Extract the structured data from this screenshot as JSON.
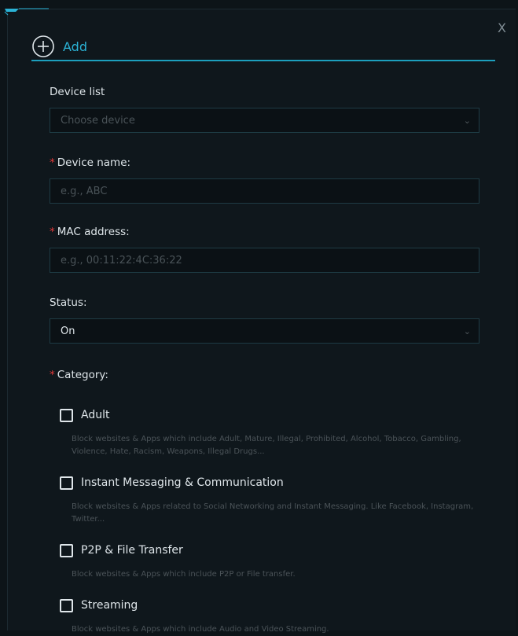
{
  "header": {
    "title": "Add",
    "close_label": "X"
  },
  "fields": {
    "device_list": {
      "label": "Device list",
      "placeholder": "Choose device"
    },
    "device_name": {
      "required_mark": "*",
      "label": "Device name:",
      "placeholder": "e.g., ABC"
    },
    "mac_address": {
      "required_mark": "*",
      "label": "MAC address:",
      "placeholder": "e.g., 00:11:22:4C:36:22"
    },
    "status": {
      "label": "Status:",
      "value": "On"
    },
    "category": {
      "required_mark": "*",
      "label": "Category:"
    }
  },
  "categories": [
    {
      "title": "Adult",
      "checked": false,
      "description": "Block websites & Apps which include Adult, Mature, Illegal, Prohibited, Alcohol, Tobacco, Gambling, Violence, Hate, Racism, Weapons, Illegal Drugs..."
    },
    {
      "title": "Instant Messaging & Communication",
      "checked": false,
      "description": "Block websites & Apps related to Social Networking and Instant Messaging. Like Facebook, Instagram, Twitter..."
    },
    {
      "title": "P2P & File Transfer",
      "checked": false,
      "description": "Block websites & Apps which include P2P or File transfer."
    },
    {
      "title": "Streaming",
      "checked": false,
      "description": "Block websites & Apps which include Audio and Video Streaming."
    }
  ],
  "colors": {
    "accent": "#2bb3d6",
    "required": "#e23a3a",
    "background": "#0f171c"
  }
}
